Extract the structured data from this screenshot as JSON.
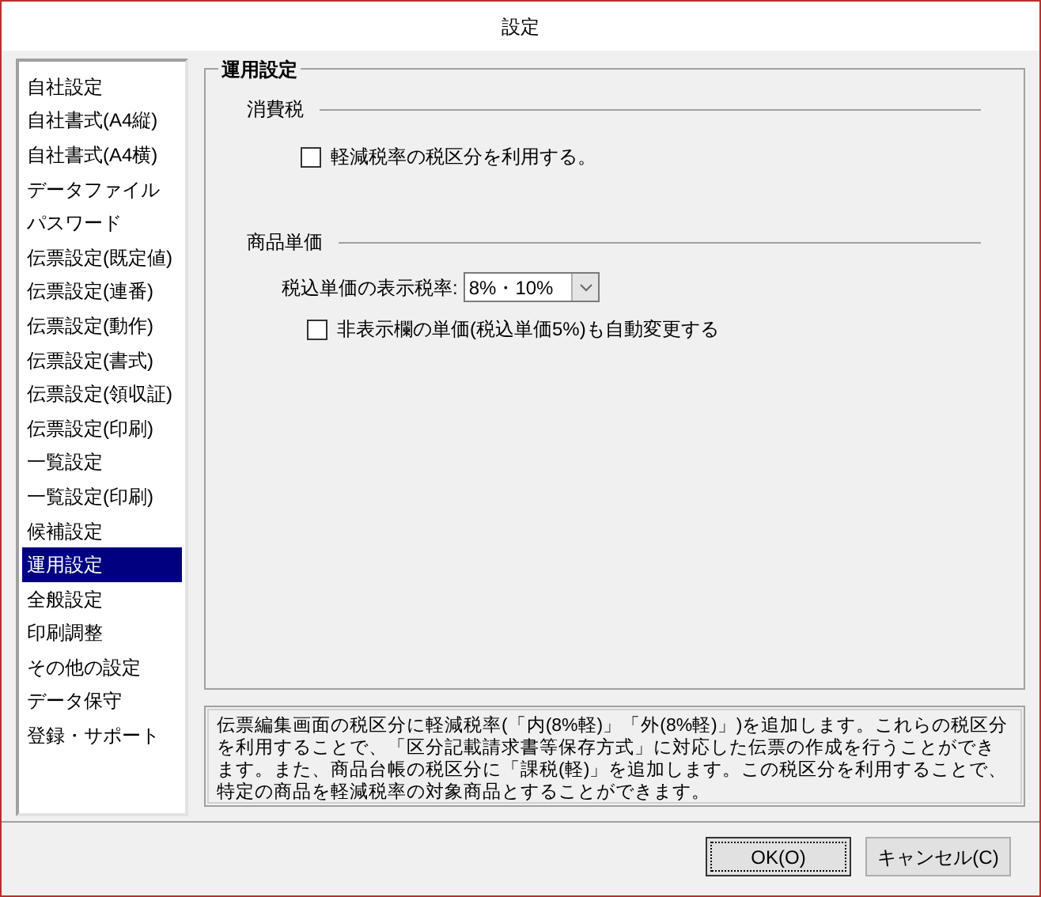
{
  "window": {
    "title": "設定"
  },
  "sidebar": {
    "items": [
      {
        "label": "自社設定",
        "selected": false
      },
      {
        "label": "自社書式(A4縦)",
        "selected": false
      },
      {
        "label": "自社書式(A4横)",
        "selected": false
      },
      {
        "label": "データファイル",
        "selected": false
      },
      {
        "label": "パスワード",
        "selected": false
      },
      {
        "label": "伝票設定(既定値)",
        "selected": false
      },
      {
        "label": "伝票設定(連番)",
        "selected": false
      },
      {
        "label": "伝票設定(動作)",
        "selected": false
      },
      {
        "label": "伝票設定(書式)",
        "selected": false
      },
      {
        "label": "伝票設定(領収証)",
        "selected": false
      },
      {
        "label": "伝票設定(印刷)",
        "selected": false
      },
      {
        "label": "一覧設定",
        "selected": false
      },
      {
        "label": "一覧設定(印刷)",
        "selected": false
      },
      {
        "label": "候補設定",
        "selected": false
      },
      {
        "label": "運用設定",
        "selected": true
      },
      {
        "label": "全般設定",
        "selected": false
      },
      {
        "label": "印刷調整",
        "selected": false
      },
      {
        "label": "その他の設定",
        "selected": false
      },
      {
        "label": "データ保守",
        "selected": false
      },
      {
        "label": "登録・サポート",
        "selected": false
      }
    ]
  },
  "panel": {
    "title": "運用設定",
    "sections": [
      {
        "heading": "消費税",
        "rows": [
          {
            "kind": "checkbox",
            "label": "軽減税率の税区分を利用する。",
            "checked": false
          }
        ]
      },
      {
        "heading": "商品単価",
        "rows": [
          {
            "kind": "select",
            "label": "税込単価の表示税率:",
            "value": "8%・10%"
          },
          {
            "kind": "checkbox",
            "label": "非表示欄の単価(税込単価5%)も自動変更する",
            "checked": false
          }
        ]
      }
    ]
  },
  "description": "伝票編集画面の税区分に軽減税率(「内(8%軽)」「外(8%軽)」)を追加します。これらの税区分を利用することで、「区分記載請求書等保存方式」に対応した伝票の作成を行うことができます。また、商品台帳の税区分に「課税(軽)」を追加します。この税区分を利用することで、特定の商品を軽減税率の対象商品とすることができます。",
  "buttons": [
    {
      "label": "OK(O)",
      "default": true
    },
    {
      "label": "キャンセル(C)",
      "default": false
    }
  ]
}
